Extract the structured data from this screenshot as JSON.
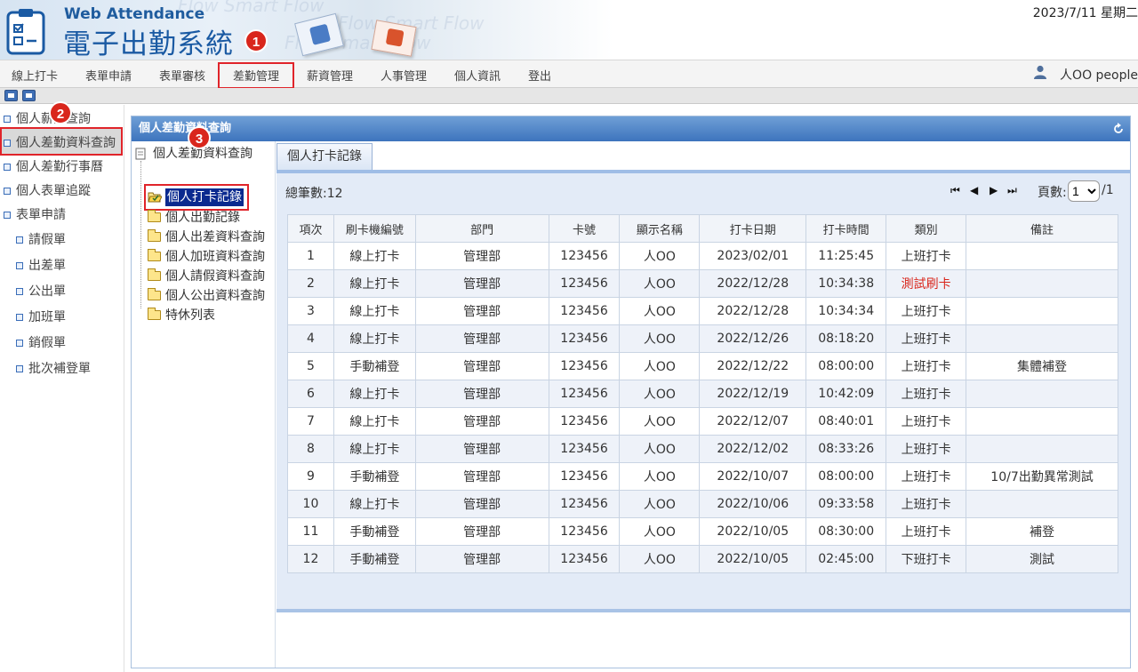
{
  "header": {
    "logo_en": "Web Attendance",
    "logo_zh": "電子出勤系統",
    "watermark": "Flow Smart Flow",
    "date": "2023/7/11 星期二"
  },
  "nav": {
    "items": [
      "線上打卡",
      "表單申請",
      "表單審核",
      "差勤管理",
      "薪資管理",
      "人事管理",
      "個人資訊",
      "登出"
    ],
    "user": "人OO people"
  },
  "badges": [
    "1",
    "2",
    "3"
  ],
  "sidebar": {
    "items": [
      "個人薪資查詢",
      "個人差勤資料查詢",
      "個人差勤行事曆",
      "個人表單追蹤",
      "表單申請",
      "請假單",
      "出差單",
      "公出單",
      "加班單",
      "銷假單",
      "批次補登單"
    ]
  },
  "panel": {
    "title": "個人差勤資料查詢"
  },
  "tree": {
    "root": "個人差勤資料查詢",
    "nodes": [
      "個人打卡記錄",
      "個人出勤記錄",
      "個人出差資料查詢",
      "個人加班資料查詢",
      "個人請假資料查詢",
      "個人公出資料查詢",
      "特休列表"
    ]
  },
  "tab": {
    "label": "個人打卡記錄"
  },
  "grid": {
    "total": "總筆數:12",
    "page_label": "頁數:",
    "page_value": "1",
    "page_total": "/1",
    "columns": [
      "項次",
      "刷卡機編號",
      "部門",
      "卡號",
      "顯示名稱",
      "打卡日期",
      "打卡時間",
      "類別",
      "備註"
    ],
    "rows": [
      [
        "1",
        "線上打卡",
        "管理部",
        "123456",
        "人OO",
        "2023/02/01",
        "11:25:45",
        "上班打卡",
        ""
      ],
      [
        "2",
        "線上打卡",
        "管理部",
        "123456",
        "人OO",
        "2022/12/28",
        "10:34:38",
        "測試刷卡",
        ""
      ],
      [
        "3",
        "線上打卡",
        "管理部",
        "123456",
        "人OO",
        "2022/12/28",
        "10:34:34",
        "上班打卡",
        ""
      ],
      [
        "4",
        "線上打卡",
        "管理部",
        "123456",
        "人OO",
        "2022/12/26",
        "08:18:20",
        "上班打卡",
        ""
      ],
      [
        "5",
        "手動補登",
        "管理部",
        "123456",
        "人OO",
        "2022/12/22",
        "08:00:00",
        "上班打卡",
        "集體補登"
      ],
      [
        "6",
        "線上打卡",
        "管理部",
        "123456",
        "人OO",
        "2022/12/19",
        "10:42:09",
        "上班打卡",
        ""
      ],
      [
        "7",
        "線上打卡",
        "管理部",
        "123456",
        "人OO",
        "2022/12/07",
        "08:40:01",
        "上班打卡",
        ""
      ],
      [
        "8",
        "線上打卡",
        "管理部",
        "123456",
        "人OO",
        "2022/12/02",
        "08:33:26",
        "上班打卡",
        ""
      ],
      [
        "9",
        "手動補登",
        "管理部",
        "123456",
        "人OO",
        "2022/10/07",
        "08:00:00",
        "上班打卡",
        "10/7出勤異常測試"
      ],
      [
        "10",
        "線上打卡",
        "管理部",
        "123456",
        "人OO",
        "2022/10/06",
        "09:33:58",
        "上班打卡",
        ""
      ],
      [
        "11",
        "手動補登",
        "管理部",
        "123456",
        "人OO",
        "2022/10/05",
        "08:30:00",
        "上班打卡",
        "補登"
      ],
      [
        "12",
        "手動補登",
        "管理部",
        "123456",
        "人OO",
        "2022/10/05",
        "02:45:00",
        "下班打卡",
        "測試"
      ]
    ],
    "highlight_color": "#d9261c"
  },
  "icons": {
    "logo": "clipboard-check-icon",
    "user": "user-icon",
    "refresh": "refresh-icon",
    "first": "first-page-icon",
    "prev": "prev-page-icon",
    "next": "next-page-icon",
    "last": "last-page-icon"
  }
}
